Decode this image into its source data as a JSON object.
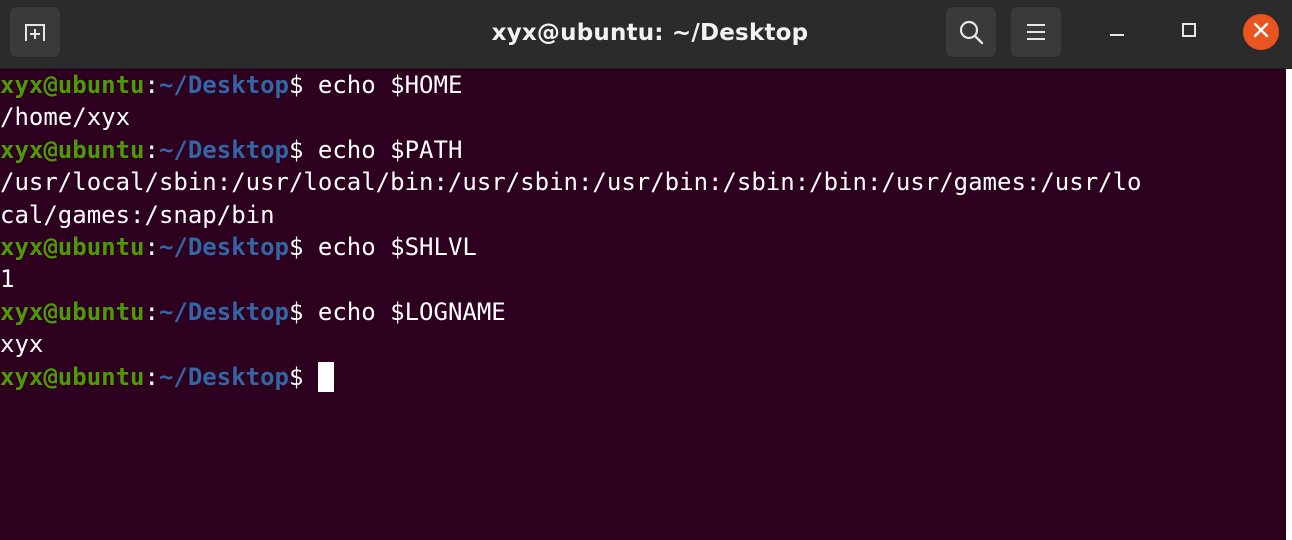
{
  "window": {
    "title": "xyx@ubuntu: ~/Desktop"
  },
  "header": {
    "icons": {
      "new_tab": "new-tab-icon",
      "search": "search-icon",
      "menu": "hamburger-menu-icon",
      "minimize": "minimize-icon",
      "maximize": "maximize-icon",
      "close": "close-icon"
    },
    "close_color": "#e95420"
  },
  "colors": {
    "terminal_bg": "#2c001e",
    "user_host": "#4e9a06",
    "path": "#3465a4",
    "text": "#ffffff"
  },
  "terminal": {
    "lines": [
      {
        "type": "prompt",
        "user": "xyx@ubuntu",
        "sep": ":",
        "path": "~/Desktop",
        "dollar": "$ ",
        "cmd": "echo $HOME"
      },
      {
        "type": "output",
        "text": "/home/xyx"
      },
      {
        "type": "prompt",
        "user": "xyx@ubuntu",
        "sep": ":",
        "path": "~/Desktop",
        "dollar": "$ ",
        "cmd": "echo $PATH"
      },
      {
        "type": "output",
        "text": "/usr/local/sbin:/usr/local/bin:/usr/sbin:/usr/bin:/sbin:/bin:/usr/games:/usr/lo"
      },
      {
        "type": "output",
        "text": "cal/games:/snap/bin"
      },
      {
        "type": "prompt",
        "user": "xyx@ubuntu",
        "sep": ":",
        "path": "~/Desktop",
        "dollar": "$ ",
        "cmd": "echo $SHLVL"
      },
      {
        "type": "output",
        "text": "1"
      },
      {
        "type": "prompt",
        "user": "xyx@ubuntu",
        "sep": ":",
        "path": "~/Desktop",
        "dollar": "$ ",
        "cmd": "echo $LOGNAME"
      },
      {
        "type": "output",
        "text": "xyx"
      },
      {
        "type": "prompt",
        "user": "xyx@ubuntu",
        "sep": ":",
        "path": "~/Desktop",
        "dollar": "$ ",
        "cmd": "",
        "cursor": true
      }
    ]
  }
}
